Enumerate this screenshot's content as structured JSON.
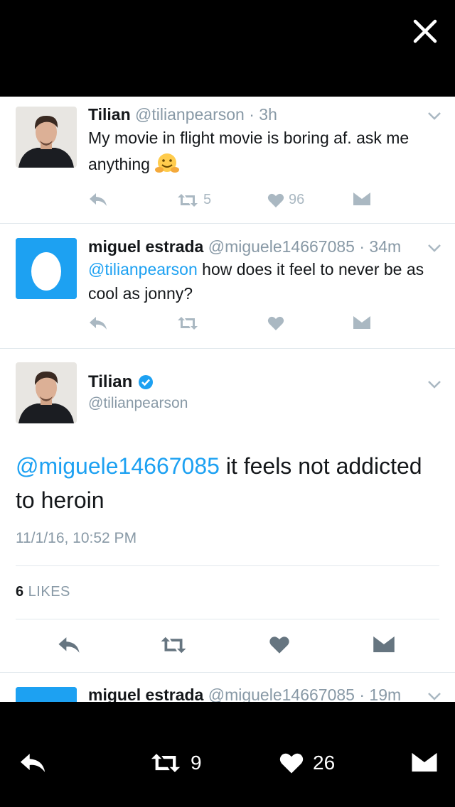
{
  "icons": {
    "close": "close-icon",
    "reply": "reply-icon",
    "retweet": "retweet-icon",
    "like": "heart-icon",
    "dm": "direct-message-icon",
    "chevron": "chevron-down-icon",
    "verified": "verified-badge-icon"
  },
  "colors": {
    "link": "#1da1f2",
    "secondary": "#8899a6",
    "text": "#14171a",
    "action": "#aab8c2",
    "egg_bg": "#1da1f2"
  },
  "tweet1": {
    "name": "Tilian",
    "handle": "@tilianpearson",
    "dot": " · ",
    "time": "3h",
    "text": "My movie in flight movie is boring af. ask me anything",
    "emoji": "hugging-face",
    "retweets": "5",
    "likes": "96"
  },
  "tweet2": {
    "name": "miguel estrada",
    "handle": "@miguele14667085",
    "dot": " · ",
    "time": "34m",
    "mention": "@tilianpearson",
    "text": " how does it feel to never be as cool as jonny?"
  },
  "detail": {
    "name": "Tilian",
    "handle": "@tilianpearson",
    "mention": "@miguele14667085",
    "text": " it feels not addicted to heroin",
    "timestamp": "11/1/16, 10:52 PM",
    "likes_count": "6",
    "likes_label": " LIKES"
  },
  "tweet4": {
    "name": "miguel estrada",
    "handle": "@miguele14667085",
    "dot": " · ",
    "time": "19m"
  },
  "bottom": {
    "retweets": "9",
    "likes": "26"
  }
}
